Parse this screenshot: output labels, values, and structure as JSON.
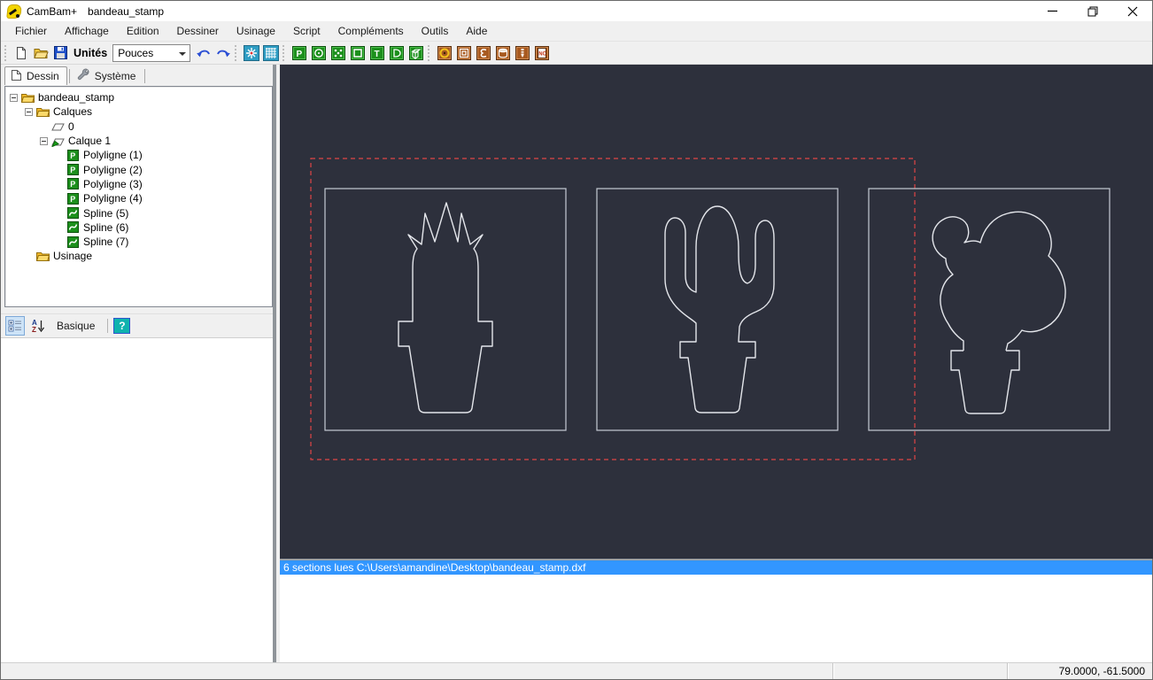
{
  "window": {
    "app_title": "CamBam+",
    "doc_title": "bandeau_stamp",
    "controls": [
      {
        "name": "minimize-button",
        "icon": "minimize-icon"
      },
      {
        "name": "restore-button",
        "icon": "restore-icon"
      },
      {
        "name": "close-button",
        "icon": "close-icon"
      }
    ]
  },
  "menu": {
    "items": [
      "Fichier",
      "Affichage",
      "Edition",
      "Dessiner",
      "Usinage",
      "Script",
      "Compléments",
      "Outils",
      "Aide"
    ]
  },
  "toolbar": {
    "units_label": "Unités",
    "units_value": "Pouces",
    "groups": [
      {
        "items": [
          {
            "name": "new-file-button",
            "icon": "new-file-icon"
          },
          {
            "name": "open-file-button",
            "icon": "open-folder-icon"
          },
          {
            "name": "save-button",
            "icon": "save-icon"
          }
        ]
      },
      {
        "items": [
          {
            "name": "undo-button",
            "icon": "undo-icon"
          },
          {
            "name": "redo-button",
            "icon": "redo-icon"
          }
        ]
      },
      {
        "items": [
          {
            "name": "toggle-axes-button",
            "icon": "axes-icon"
          },
          {
            "name": "toggle-grid-button",
            "icon": "grid-icon"
          }
        ]
      },
      {
        "items": [
          {
            "name": "draw-polyline-button",
            "icon": "polyline-tool-icon"
          },
          {
            "name": "draw-circle-button",
            "icon": "circle-tool-icon"
          },
          {
            "name": "draw-points-button",
            "icon": "pointlist-tool-icon"
          },
          {
            "name": "draw-rectangle-button",
            "icon": "rectangle-tool-icon"
          },
          {
            "name": "draw-text-button",
            "icon": "text-tool-icon"
          },
          {
            "name": "draw-arc-button",
            "icon": "arc-tool-icon"
          },
          {
            "name": "draw-surface-button",
            "icon": "surface-tool-icon"
          }
        ]
      },
      {
        "items": [
          {
            "name": "mop-drill-button",
            "icon": "drill-op-icon"
          },
          {
            "name": "mop-pocket-button",
            "icon": "pocket-op-icon"
          },
          {
            "name": "mop-engrave-button",
            "icon": "engrave-op-icon"
          },
          {
            "name": "mop-profile-button",
            "icon": "profile-op-icon"
          },
          {
            "name": "mop-3dprofile-button",
            "icon": "drillbit-op-icon"
          },
          {
            "name": "mop-gcode-button",
            "icon": "gcode-op-icon"
          }
        ]
      }
    ]
  },
  "tabs": [
    {
      "label": "Dessin",
      "icon": "page-icon",
      "active": true,
      "name": "tab-dessin"
    },
    {
      "label": "Système",
      "icon": "wrench-icon",
      "active": false,
      "name": "tab-systeme"
    }
  ],
  "tree": {
    "items": [
      {
        "label": "bandeau_stamp",
        "level": 0,
        "expand": "minus",
        "icon": "folder-icon",
        "name": "tree-item-bandeau-stamp"
      },
      {
        "label": "Calques",
        "level": 1,
        "expand": "minus",
        "icon": "folder-icon",
        "name": "tree-item-calques"
      },
      {
        "label": "0",
        "level": 2,
        "expand": "none",
        "icon": "layer-icon",
        "name": "tree-item-layer-0"
      },
      {
        "label": "Calque 1",
        "level": 2,
        "expand": "minus",
        "icon": "layer-active-icon",
        "name": "tree-item-calque-1"
      },
      {
        "label": "Polyligne (1)",
        "level": 3,
        "expand": "none",
        "icon": "polyline-obj-icon",
        "name": "tree-item-polyligne-1"
      },
      {
        "label": "Polyligne (2)",
        "level": 3,
        "expand": "none",
        "icon": "polyline-obj-icon",
        "name": "tree-item-polyligne-2"
      },
      {
        "label": "Polyligne (3)",
        "level": 3,
        "expand": "none",
        "icon": "polyline-obj-icon",
        "name": "tree-item-polyligne-3"
      },
      {
        "label": "Polyligne (4)",
        "level": 3,
        "expand": "none",
        "icon": "polyline-obj-icon",
        "name": "tree-item-polyligne-4"
      },
      {
        "label": "Spline (5)",
        "level": 3,
        "expand": "none",
        "icon": "spline-obj-icon",
        "name": "tree-item-spline-5"
      },
      {
        "label": "Spline (6)",
        "level": 3,
        "expand": "none",
        "icon": "spline-obj-icon",
        "name": "tree-item-spline-6"
      },
      {
        "label": "Spline (7)",
        "level": 3,
        "expand": "none",
        "icon": "spline-obj-icon",
        "name": "tree-item-spline-7"
      },
      {
        "label": "Usinage",
        "level": 1,
        "expand": "none",
        "icon": "folder-icon",
        "name": "tree-item-usinage"
      }
    ]
  },
  "properties": {
    "view_label": "Basique",
    "help_label": "?"
  },
  "log": {
    "message": "6 sections lues C:\\Users\\amandine\\Desktop\\bandeau_stamp.dxf"
  },
  "statusbar": {
    "coords": "79.0000, -61.5000"
  },
  "colors": {
    "canvas_bg": "#2d303c",
    "outline": "#e4e6eb",
    "frame": "#c6cbd4",
    "selection_red": "#e04545",
    "log_highlight": "#3296ff",
    "tool_green": "#1c8f1c",
    "tool_brown": "#a85a20",
    "tool_teal": "#2f9ec4"
  }
}
